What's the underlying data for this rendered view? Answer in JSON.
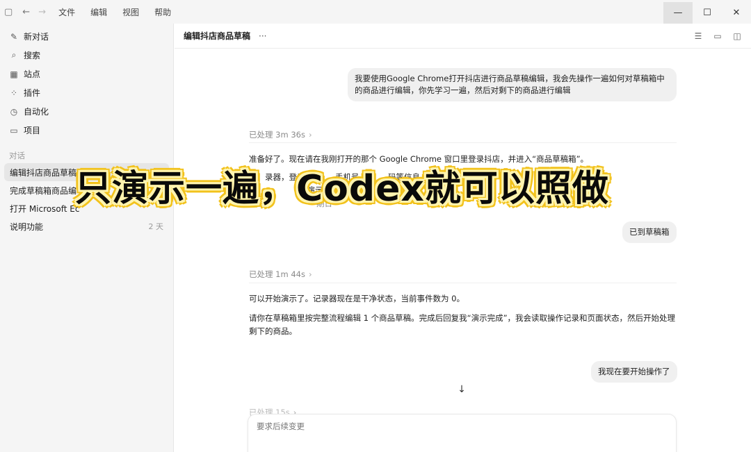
{
  "menu": {
    "file": "文件",
    "edit": "编辑",
    "view": "视图",
    "help": "帮助"
  },
  "sidebar": {
    "nav": [
      {
        "label": "新对话",
        "icon": "edit-icon"
      },
      {
        "label": "搜索",
        "icon": "search-icon"
      },
      {
        "label": "站点",
        "icon": "sites-icon"
      },
      {
        "label": "插件",
        "icon": "plugins-icon"
      },
      {
        "label": "自动化",
        "icon": "clock-icon"
      },
      {
        "label": "项目",
        "icon": "folder-icon"
      }
    ],
    "section_label": "对话",
    "conversations": [
      {
        "title": "编辑抖店商品草稿",
        "age": ""
      },
      {
        "title": "完成草稿箱商品编",
        "age": ""
      },
      {
        "title": "打开 Microsoft Ec",
        "age": ""
      },
      {
        "title": "说明功能",
        "age": "2 天"
      }
    ]
  },
  "header": {
    "title": "编辑抖店商品草稿",
    "more": "···"
  },
  "chat": {
    "user_msg_1": "我要使用Google Chrome打开抖店进行商品草稿编辑，我会先操作一遍如何对草稿箱中的商品进行编辑，你先学习一遍，然后对剩下的商品进行编辑",
    "processed_1": "已处理 3m 36s",
    "assist_1_line1": "准备好了。现在请在我刚打开的那个 Google Chrome 窗口里登录抖店，并进入“商品草稿箱”。",
    "assist_1_line2": "录器，登录",
    "assist_1_line2b": "手机号、",
    "assist_1_line2c": "码等信息。",
    "assist_1_line3": "再演示编",
    "assist_1_line4": "期日",
    "user_msg_2": "已到草稿箱",
    "processed_2": "已处理 1m 44s",
    "assist_2_line1": "可以开始演示了。记录器现在是干净状态，当前事件数为 0。",
    "assist_2_line2": "请你在草稿箱里按完整流程编辑 1 个商品草稿。完成后回复我“演示完成”，我会读取操作记录和页面状态，然后开始处理剩下的商品。",
    "user_msg_3": "我现在要开始操作了",
    "processed_3": "已处理 15s"
  },
  "composer": {
    "placeholder": "要求后续变更"
  },
  "overlay": {
    "caption": "只演示一遍，Codex就可以照做"
  },
  "colors": {
    "caption_outline": "#f2c21c",
    "caption_fill": "#0a0a0a"
  }
}
